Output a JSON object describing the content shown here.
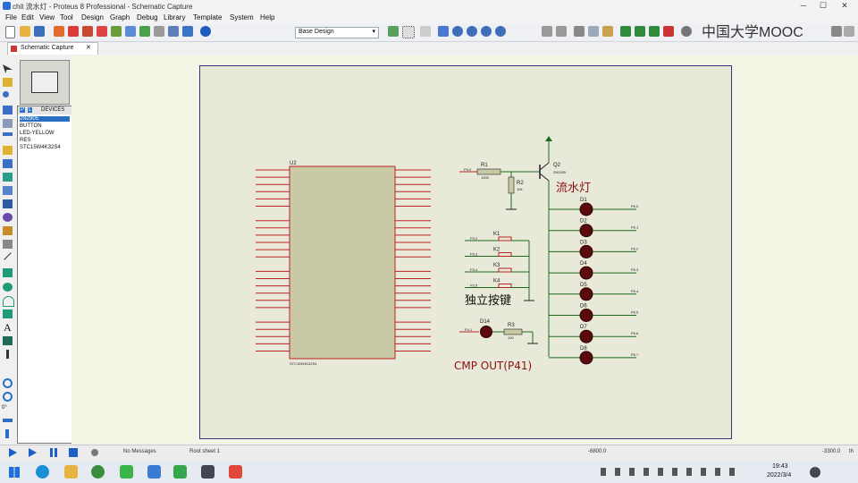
{
  "window": {
    "title": "chit 流水灯 - Proteus 8 Professional - Schematic Capture",
    "min": "─",
    "max": "☐",
    "close": "✕"
  },
  "menu": [
    "File",
    "Edit",
    "View",
    "Tool",
    "Design",
    "Graph",
    "Debug",
    "Library",
    "Template",
    "System",
    "Help"
  ],
  "toolbar": {
    "dropdown_value": "Base Design"
  },
  "tab": {
    "label": "Schematic Capture",
    "close": "✕"
  },
  "devices": {
    "header": "DEVICES",
    "p": "P",
    "l": "L",
    "items": [
      "2N2905",
      "BUTTON",
      "LED-YELLOW",
      "RES",
      "STC15W4K32S4"
    ]
  },
  "watermark": "中国大学MOOC",
  "schematic": {
    "title": "流水灯",
    "keys_label": "独立按键",
    "cmp_label": "CMP OUT(P41)",
    "u2_ref": "U2",
    "u2_part": "STC15W4K32S4",
    "q2": {
      "ref": "Q2",
      "part": "2N2905"
    },
    "r1": {
      "ref": "R1",
      "val": "1000"
    },
    "r2": {
      "ref": "R2",
      "val": "10k"
    },
    "r3": {
      "ref": "R3",
      "val": "100"
    },
    "d14": "D14",
    "p40": "P4.0",
    "p41": "P4.1",
    "keys": [
      {
        "ref": "K1",
        "net": "P3.2"
      },
      {
        "ref": "K2",
        "net": "P3.3"
      },
      {
        "ref": "K3",
        "net": "P3.4"
      },
      {
        "ref": "K4",
        "net": "P3.5"
      }
    ],
    "leds": [
      {
        "ref": "D1",
        "net": "P6.0"
      },
      {
        "ref": "D2",
        "net": "P6.1"
      },
      {
        "ref": "D3",
        "net": "P6.2"
      },
      {
        "ref": "D4",
        "net": "P6.3"
      },
      {
        "ref": "D5",
        "net": "P6.4"
      },
      {
        "ref": "D6",
        "net": "P6.5"
      },
      {
        "ref": "D7",
        "net": "P6.6"
      },
      {
        "ref": "D8",
        "net": "P6.7"
      }
    ]
  },
  "status": {
    "messages": "No Messages",
    "sheet": "Root sheet 1",
    "x": "-6800.0",
    "y": "-3300.0",
    "unit": "th"
  },
  "taskbar": {
    "time": "19:43",
    "date": "2022/3/4"
  }
}
